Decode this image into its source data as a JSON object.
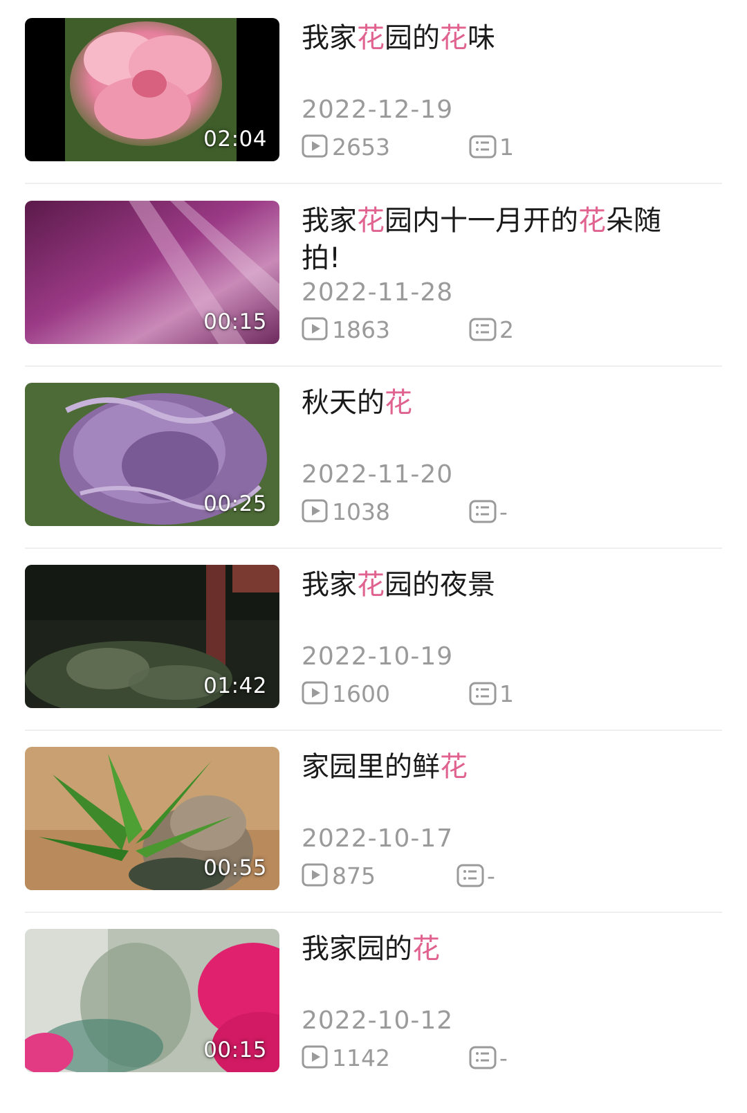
{
  "videos": [
    {
      "title_parts": [
        {
          "text": "我家",
          "hl": false
        },
        {
          "text": "花",
          "hl": true
        },
        {
          "text": "园的",
          "hl": false
        },
        {
          "text": "花",
          "hl": true
        },
        {
          "text": "味",
          "hl": false
        }
      ],
      "duration": "02:04",
      "date": "2022-12-19",
      "views": "2653",
      "comments": "1",
      "thumbnail_subject": "pink-flower"
    },
    {
      "title_parts": [
        {
          "text": "我家",
          "hl": false
        },
        {
          "text": "花",
          "hl": true
        },
        {
          "text": "园内十一月开的",
          "hl": false
        },
        {
          "text": "花",
          "hl": true
        },
        {
          "text": "朵随拍!",
          "hl": false
        }
      ],
      "duration": "00:15",
      "date": "2022-11-28",
      "views": "1863",
      "comments": "2",
      "thumbnail_subject": "purple-blur"
    },
    {
      "title_parts": [
        {
          "text": "秋天的",
          "hl": false
        },
        {
          "text": "花",
          "hl": true
        }
      ],
      "duration": "00:25",
      "date": "2022-11-20",
      "views": "1038",
      "comments": "-",
      "thumbnail_subject": "purple-cockscomb"
    },
    {
      "title_parts": [
        {
          "text": "我家",
          "hl": false
        },
        {
          "text": "花",
          "hl": true
        },
        {
          "text": "园的夜景",
          "hl": false
        }
      ],
      "duration": "01:42",
      "date": "2022-10-19",
      "views": "1600",
      "comments": "1",
      "thumbnail_subject": "night-garden"
    },
    {
      "title_parts": [
        {
          "text": "家园里的鲜",
          "hl": false
        },
        {
          "text": "花",
          "hl": true
        }
      ],
      "duration": "00:55",
      "date": "2022-10-17",
      "views": "875",
      "comments": "-",
      "thumbnail_subject": "potted-plant"
    },
    {
      "title_parts": [
        {
          "text": "我家园的",
          "hl": false
        },
        {
          "text": "花",
          "hl": true
        }
      ],
      "duration": "00:15",
      "date": "2022-10-12",
      "views": "1142",
      "comments": "-",
      "thumbnail_subject": "magenta-flower"
    }
  ],
  "colors": {
    "highlight": "#e0628f",
    "title": "#1a1a1a",
    "meta": "#9a9a9a"
  },
  "icons": {
    "views": "play-icon",
    "comments": "comment-icon"
  }
}
